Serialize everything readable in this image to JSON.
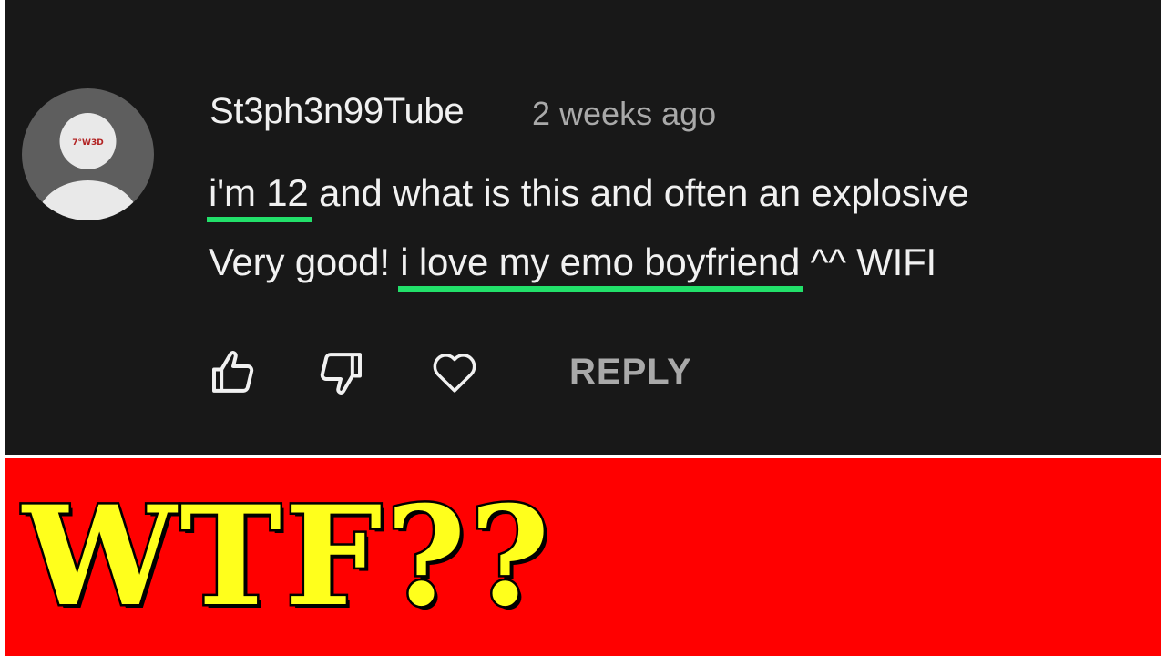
{
  "comment": {
    "author": "St3ph3n99Tube",
    "timestamp": "2 weeks ago",
    "avatar_icon": "default-profile-avatar",
    "avatar_badge_text": "7°W3D",
    "line1": {
      "highlight": "i'm 12",
      "rest": " and what is this and often an explosive"
    },
    "line2": {
      "before": "Very good! ",
      "highlight": "i love my emo boyfriend",
      "after": " ^^ WIFI"
    },
    "highlight_color": "#22e06a"
  },
  "actions": {
    "like_icon": "thumbs-up-icon",
    "dislike_icon": "thumbs-down-icon",
    "heart_icon": "heart-icon",
    "reply_label": "REPLY"
  },
  "banner": {
    "text": "WTF??",
    "background_color": "#ff0000",
    "text_color": "#ffff1c"
  }
}
